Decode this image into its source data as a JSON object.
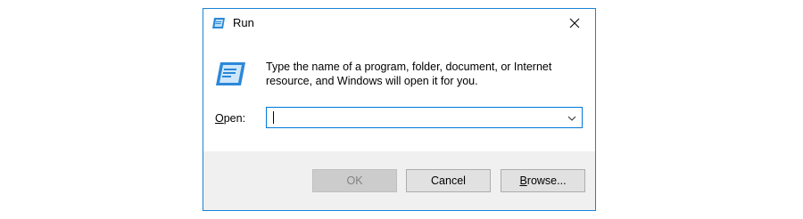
{
  "window": {
    "title": "Run",
    "title_icon": "run-app-icon",
    "close_icon": "close-icon"
  },
  "content": {
    "icon": "run-icon",
    "description": "Type the name of a program, folder, document, or Internet resource, and Windows will open it for you.",
    "open_label_accel": "O",
    "open_label_rest": "pen:",
    "open_value": "",
    "open_placeholder": "",
    "dropdown_icon": "chevron-down-icon"
  },
  "buttons": {
    "ok_label": "OK",
    "ok_disabled": true,
    "cancel_label": "Cancel",
    "browse_label_accel": "B",
    "browse_label_rest": "rowse..."
  },
  "colors": {
    "accent": "#0078d7",
    "window_border": "#1883d7",
    "footer_bg": "#f0f0f0",
    "button_bg": "#e1e1e1",
    "button_disabled_bg": "#cccccc",
    "button_disabled_text": "#838383"
  }
}
